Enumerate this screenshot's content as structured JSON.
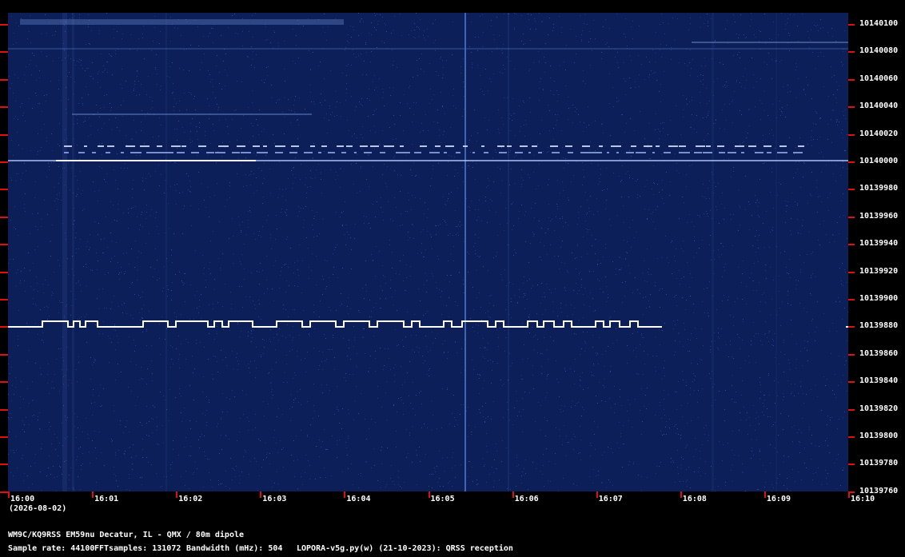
{
  "plot": {
    "background": "#0c1f58",
    "tick_color": "#e01010",
    "y_labels": [
      "10140100",
      "10140080",
      "10140060",
      "10140040",
      "10140020",
      "10140000",
      "10139980",
      "10139960",
      "10139940",
      "10139920",
      "10139900",
      "10139880",
      "10139860",
      "10139840",
      "10139820",
      "10139800",
      "10139780",
      "10139760"
    ],
    "x_labels": [
      "16:00",
      "16:01",
      "16:02",
      "16:03",
      "16:04",
      "16:05",
      "16:06",
      "16:07",
      "16:08",
      "16:09",
      "16:10"
    ],
    "date": "(2026-08-02)"
  },
  "footer": {
    "station": "WM9C/KQ9RSS EM59nu Decatur, IL - QMX / 80m dipole",
    "sample_rate": "Sample rate: 44100",
    "fft": "FFTsamples: 131072",
    "bandwidth": "Bandwidth (mHz): 504",
    "software": "LOPORA-v5g.py(w) (21-10-2023): QRSS reception"
  }
}
